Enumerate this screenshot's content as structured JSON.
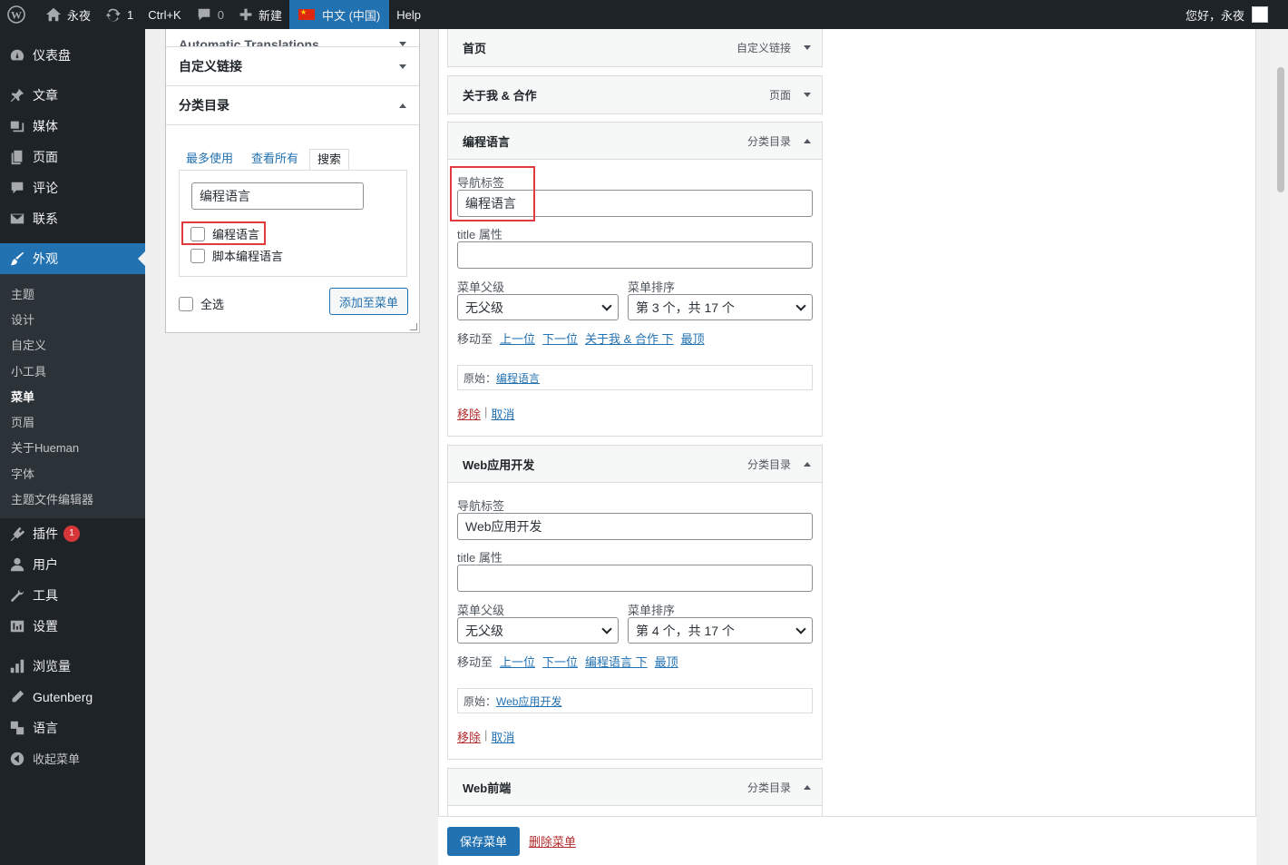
{
  "adminbar": {
    "site_name": "永夜",
    "updates": "1",
    "shortcut": "Ctrl+K",
    "comments": "0",
    "new_label": "新建",
    "language": "中文 (中国)",
    "help": "Help",
    "greeting": "您好，永夜"
  },
  "sidebar": {
    "items": [
      {
        "label": "仪表盘",
        "icon": "dashboard-icon"
      },
      {
        "label": "文章",
        "icon": "pin-icon"
      },
      {
        "label": "媒体",
        "icon": "media-icon"
      },
      {
        "label": "页面",
        "icon": "page-icon"
      },
      {
        "label": "评论",
        "icon": "comment-icon"
      },
      {
        "label": "联系",
        "icon": "mail-icon"
      },
      {
        "label": "外观",
        "icon": "brush-icon"
      },
      {
        "label": "插件",
        "icon": "plugin-icon",
        "badge": "1"
      },
      {
        "label": "用户",
        "icon": "user-icon"
      },
      {
        "label": "工具",
        "icon": "wrench-icon"
      },
      {
        "label": "设置",
        "icon": "settings-icon"
      },
      {
        "label": "浏览量",
        "icon": "chart-icon"
      },
      {
        "label": "Gutenberg",
        "icon": "pencil-icon"
      },
      {
        "label": "语言",
        "icon": "translate-icon"
      },
      {
        "label": "收起菜单",
        "icon": "collapse-icon"
      }
    ],
    "submenu": [
      "主题",
      "设计",
      "自定义",
      "小工具",
      "菜单",
      "页眉",
      "关于Hueman",
      "字体",
      "主题文件编辑器"
    ],
    "submenu_current": "菜单"
  },
  "left_panel": {
    "auto_translations": "Automatic Translations",
    "custom_links": "自定义链接",
    "categories": "分类目录",
    "tabs": [
      "最多使用",
      "查看所有",
      "搜索"
    ],
    "search_value": "编程语言",
    "results": [
      "编程语言",
      "脚本编程语言"
    ],
    "select_all": "全选",
    "add_button": "添加至菜单"
  },
  "menu_items": {
    "home": {
      "title": "首页",
      "type": "自定义链接"
    },
    "about": {
      "title": "关于我 & 合作",
      "type": "页面"
    },
    "prog": {
      "title": "编程语言",
      "type": "分类目录",
      "nav_label_caption": "导航标签",
      "nav_label": "编程语言",
      "title_attr_caption": "title 属性",
      "title_attr": "",
      "parent_caption": "菜单父级",
      "parent": "无父级",
      "order_caption": "菜单排序",
      "order": "第 3 个，共 17 个",
      "move_caption": "移动至",
      "move_up": "上一位",
      "move_down": "下一位",
      "move_under": "关于我 & 合作 下",
      "move_top": "最顶",
      "original_caption": "原始：",
      "original": "编程语言",
      "remove": "移除",
      "sep": "|",
      "cancel": "取消"
    },
    "web": {
      "title": "Web应用开发",
      "type": "分类目录",
      "nav_label_caption": "导航标签",
      "nav_label": "Web应用开发",
      "title_attr_caption": "title 属性",
      "title_attr": "",
      "parent_caption": "菜单父级",
      "parent": "无父级",
      "order_caption": "菜单排序",
      "order": "第 4 个，共 17 个",
      "move_caption": "移动至",
      "move_up": "上一位",
      "move_down": "下一位",
      "move_under": "编程语言 下",
      "move_top": "最顶",
      "original_caption": "原始：",
      "original": "Web应用开发",
      "remove": "移除",
      "sep": "|",
      "cancel": "取消"
    },
    "front": {
      "title": "Web前端",
      "type": "分类目录"
    }
  },
  "footer": {
    "save": "保存菜单",
    "delete": "删除菜单"
  }
}
